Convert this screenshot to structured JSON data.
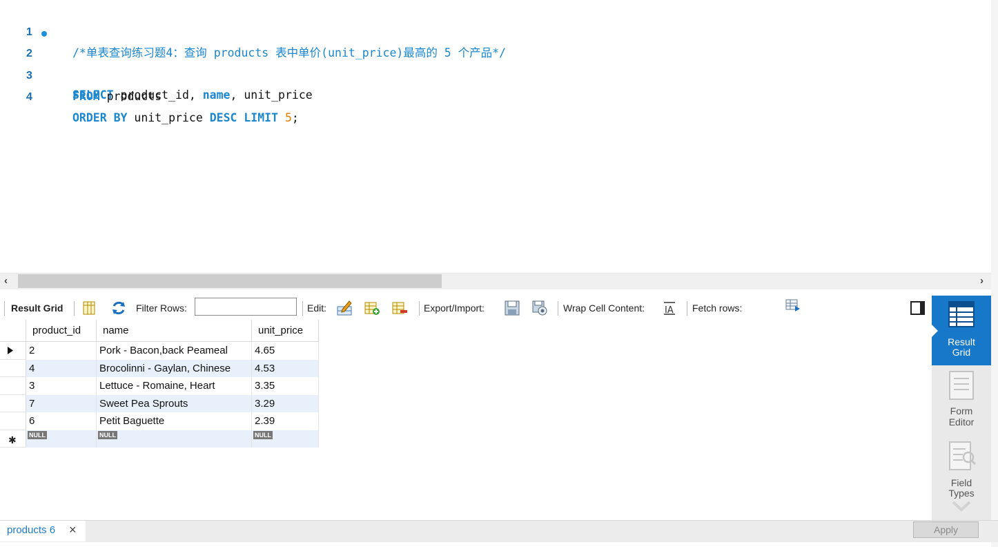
{
  "editor": {
    "lines": [
      {
        "no": "1",
        "comment": "/*单表查询练习题4：查询 products 表中单价(unit_price)最高的 5 个产品*/"
      },
      {
        "no": "2",
        "kw1": "SELECT",
        "t1": " product_id, ",
        "kw2": "name",
        "t2": ", unit_price"
      },
      {
        "no": "3",
        "kw1": "FROM",
        "t1": " products"
      },
      {
        "no": "4",
        "kw1": "ORDER BY",
        "t1": " unit_price ",
        "kw2": "DESC LIMIT",
        "t2": " ",
        "num": "5",
        "t3": ";"
      }
    ]
  },
  "toolbar": {
    "result_grid": "Result Grid",
    "filter_rows": "Filter Rows:",
    "filter_value": "",
    "edit": "Edit:",
    "export_import": "Export/Import:",
    "wrap_cell": "Wrap Cell Content:",
    "fetch_rows": "Fetch rows:"
  },
  "grid": {
    "columns": [
      "product_id",
      "name",
      "unit_price"
    ],
    "rows": [
      [
        "2",
        "Pork - Bacon,back Peameal",
        "4.65"
      ],
      [
        "4",
        "Brocolinni - Gaylan, Chinese",
        "4.53"
      ],
      [
        "3",
        "Lettuce - Romaine, Heart",
        "3.35"
      ],
      [
        "7",
        "Sweet Pea Sprouts",
        "3.29"
      ],
      [
        "6",
        "Petit Baguette",
        "2.39"
      ]
    ],
    "null_label": "NULL"
  },
  "right_panel": {
    "result_grid": [
      "Result",
      "Grid"
    ],
    "form_editor": [
      "Form",
      "Editor"
    ],
    "field_types": [
      "Field",
      "Types"
    ]
  },
  "bottom": {
    "tab_label": "products 6",
    "apply": "Apply"
  },
  "colors": {
    "keyword": "#1b87cf",
    "number": "#e07b00",
    "accent": "#1777c9",
    "row_alt": "#e8f1fb"
  }
}
